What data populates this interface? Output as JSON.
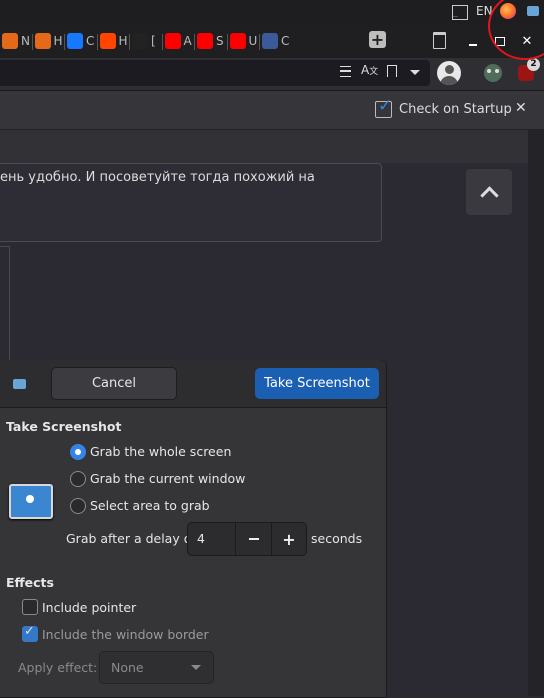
{
  "system_panel": {
    "lang": "EN"
  },
  "tabs": [
    {
      "letter": "N",
      "color": "#e46a1a"
    },
    {
      "letter": "H",
      "color": "#e46a1a"
    },
    {
      "letter": "C",
      "color": "#1677ff"
    },
    {
      "letter": "H",
      "color": "#ff4500"
    },
    {
      "letter": "[",
      "color": "#222222"
    },
    {
      "letter": "A",
      "color": "#ff0000"
    },
    {
      "letter": "S",
      "color": "#ff0000"
    },
    {
      "letter": "U",
      "color": "#ff0000"
    },
    {
      "letter": "C",
      "color": "#3a5a9a"
    }
  ],
  "extension_badge": "2",
  "notification": {
    "label": "Check on Startup"
  },
  "page": {
    "post_text": "ень удобно. И посоветуйте тогда похожий на"
  },
  "dialog": {
    "cancel_label": "Cancel",
    "take_label": "Take Screenshot",
    "section_title": "Take Screenshot",
    "options": [
      {
        "label": "Grab the whole screen",
        "selected": true
      },
      {
        "label": "Grab the current window",
        "selected": false
      },
      {
        "label": "Select area to grab",
        "selected": false
      }
    ],
    "delay_label": "Grab after a delay of",
    "delay_value": "4",
    "delay_unit": "seconds",
    "effects_title": "Effects",
    "include_pointer": {
      "label": "Include pointer",
      "checked": false
    },
    "include_border": {
      "label": "Include the window border",
      "checked": true
    },
    "apply_effect_label": "Apply effect:",
    "apply_effect_value": "None"
  },
  "colors": {
    "accent": "#3584e4",
    "take_button": "#1b5fb3",
    "annotation_circle": "#e0161b"
  }
}
